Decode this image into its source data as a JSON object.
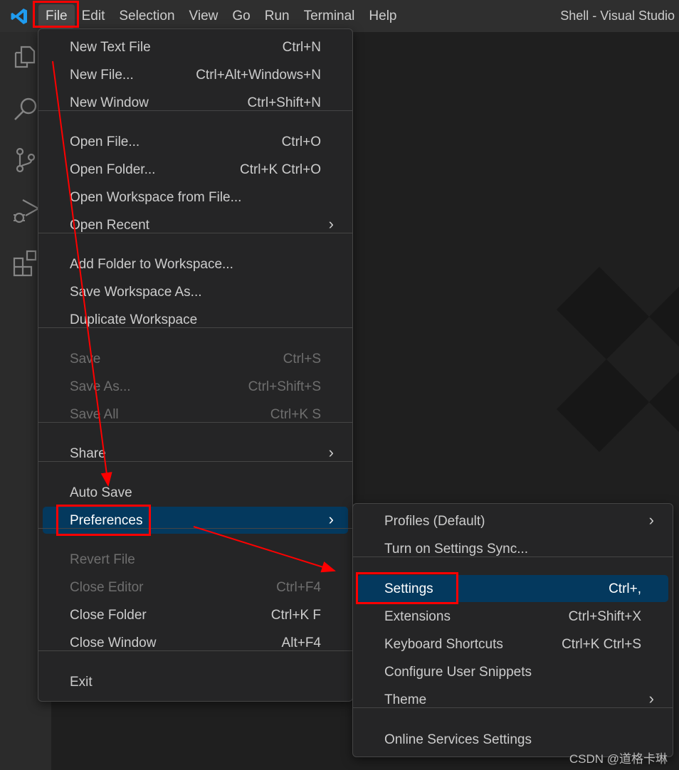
{
  "titlebar": {
    "menus": [
      "File",
      "Edit",
      "Selection",
      "View",
      "Go",
      "Run",
      "Terminal",
      "Help"
    ],
    "window_title": "Shell - Visual Studio"
  },
  "activity_bar": {
    "icons": [
      "explorer-icon",
      "search-icon",
      "source-control-icon",
      "run-debug-icon",
      "extensions-icon"
    ]
  },
  "file_menu": {
    "groups": [
      [
        {
          "label": "New Text File",
          "shortcut": "Ctrl+N"
        },
        {
          "label": "New File...",
          "shortcut": "Ctrl+Alt+Windows+N"
        },
        {
          "label": "New Window",
          "shortcut": "Ctrl+Shift+N"
        }
      ],
      [
        {
          "label": "Open File...",
          "shortcut": "Ctrl+O"
        },
        {
          "label": "Open Folder...",
          "shortcut": "Ctrl+K Ctrl+O"
        },
        {
          "label": "Open Workspace from File...",
          "shortcut": ""
        },
        {
          "label": "Open Recent",
          "shortcut": "",
          "submenu": true
        }
      ],
      [
        {
          "label": "Add Folder to Workspace...",
          "shortcut": ""
        },
        {
          "label": "Save Workspace As...",
          "shortcut": ""
        },
        {
          "label": "Duplicate Workspace",
          "shortcut": ""
        }
      ],
      [
        {
          "label": "Save",
          "shortcut": "Ctrl+S",
          "disabled": true
        },
        {
          "label": "Save As...",
          "shortcut": "Ctrl+Shift+S",
          "disabled": true
        },
        {
          "label": "Save All",
          "shortcut": "Ctrl+K S",
          "disabled": true
        }
      ],
      [
        {
          "label": "Share",
          "shortcut": "",
          "submenu": true
        }
      ],
      [
        {
          "label": "Auto Save",
          "shortcut": ""
        },
        {
          "label": "Preferences",
          "shortcut": "",
          "submenu": true,
          "selected": true
        }
      ],
      [
        {
          "label": "Revert File",
          "shortcut": "",
          "disabled": true
        },
        {
          "label": "Close Editor",
          "shortcut": "Ctrl+F4",
          "disabled": true
        },
        {
          "label": "Close Folder",
          "shortcut": "Ctrl+K F"
        },
        {
          "label": "Close Window",
          "shortcut": "Alt+F4"
        }
      ],
      [
        {
          "label": "Exit",
          "shortcut": ""
        }
      ]
    ]
  },
  "preferences_menu": {
    "groups": [
      [
        {
          "label": "Profiles (Default)",
          "shortcut": "",
          "submenu": true
        },
        {
          "label": "Turn on Settings Sync...",
          "shortcut": ""
        }
      ],
      [
        {
          "label": "Settings",
          "shortcut": "Ctrl+,",
          "selected": true
        },
        {
          "label": "Extensions",
          "shortcut": "Ctrl+Shift+X"
        },
        {
          "label": "Keyboard Shortcuts",
          "shortcut": "Ctrl+K Ctrl+S"
        },
        {
          "label": "Configure User Snippets",
          "shortcut": ""
        },
        {
          "label": "Theme",
          "shortcut": "",
          "submenu": true
        }
      ],
      [
        {
          "label": "Online Services Settings",
          "shortcut": ""
        }
      ]
    ]
  },
  "annotation_color": "#ff0000",
  "credit": "CSDN @道格卡琳"
}
